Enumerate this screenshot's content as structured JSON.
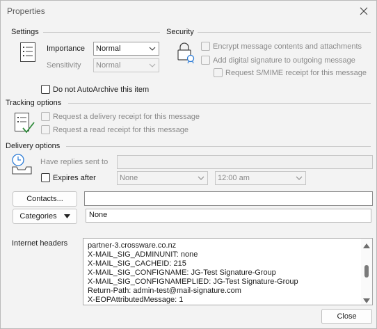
{
  "window": {
    "title": "Properties",
    "close_glyph": "✕"
  },
  "settings": {
    "heading": "Settings",
    "importance_label": "Importance",
    "importance_value": "Normal",
    "sensitivity_label": "Sensitivity",
    "sensitivity_value": "Normal",
    "autoarchive_label": "Do not AutoArchive this item"
  },
  "security": {
    "heading": "Security",
    "encrypt_label": "Encrypt message contents and attachments",
    "signature_label": "Add digital signature to outgoing message",
    "smime_label": "Request S/MIME receipt for this message"
  },
  "tracking": {
    "heading": "Tracking options",
    "delivery_receipt_label": "Request a delivery receipt for this message",
    "read_receipt_label": "Request a read receipt for this message"
  },
  "delivery": {
    "heading": "Delivery options",
    "replies_label": "Have replies sent to",
    "expires_label": "Expires after",
    "expires_date": "None",
    "expires_time": "12:00 am"
  },
  "contacts_button": "Contacts...",
  "categories": {
    "button": "Categories",
    "value": "None"
  },
  "headers": {
    "label": "Internet headers",
    "lines": [
      "partner-3.crossware.co.nz",
      "X-MAIL_SIG_ADMINUNIT: none",
      "X-MAIL_SIG_CACHEID: 215",
      "X-MAIL_SIG_CONFIGNAME: JG-Test Signature-Group",
      "X-MAIL_SIG_CONFIGNAMEPLIED: JG-Test Signature-Group",
      "Return-Path: admin-test@mail-signature.com",
      "X-EOPAttributedMessage: 1"
    ]
  },
  "close_button": "Close",
  "icons": {
    "settings": "list-icon",
    "security": "lock-certificate-icon",
    "tracking": "checklist-icon",
    "delivery": "clock-tray-icon"
  }
}
